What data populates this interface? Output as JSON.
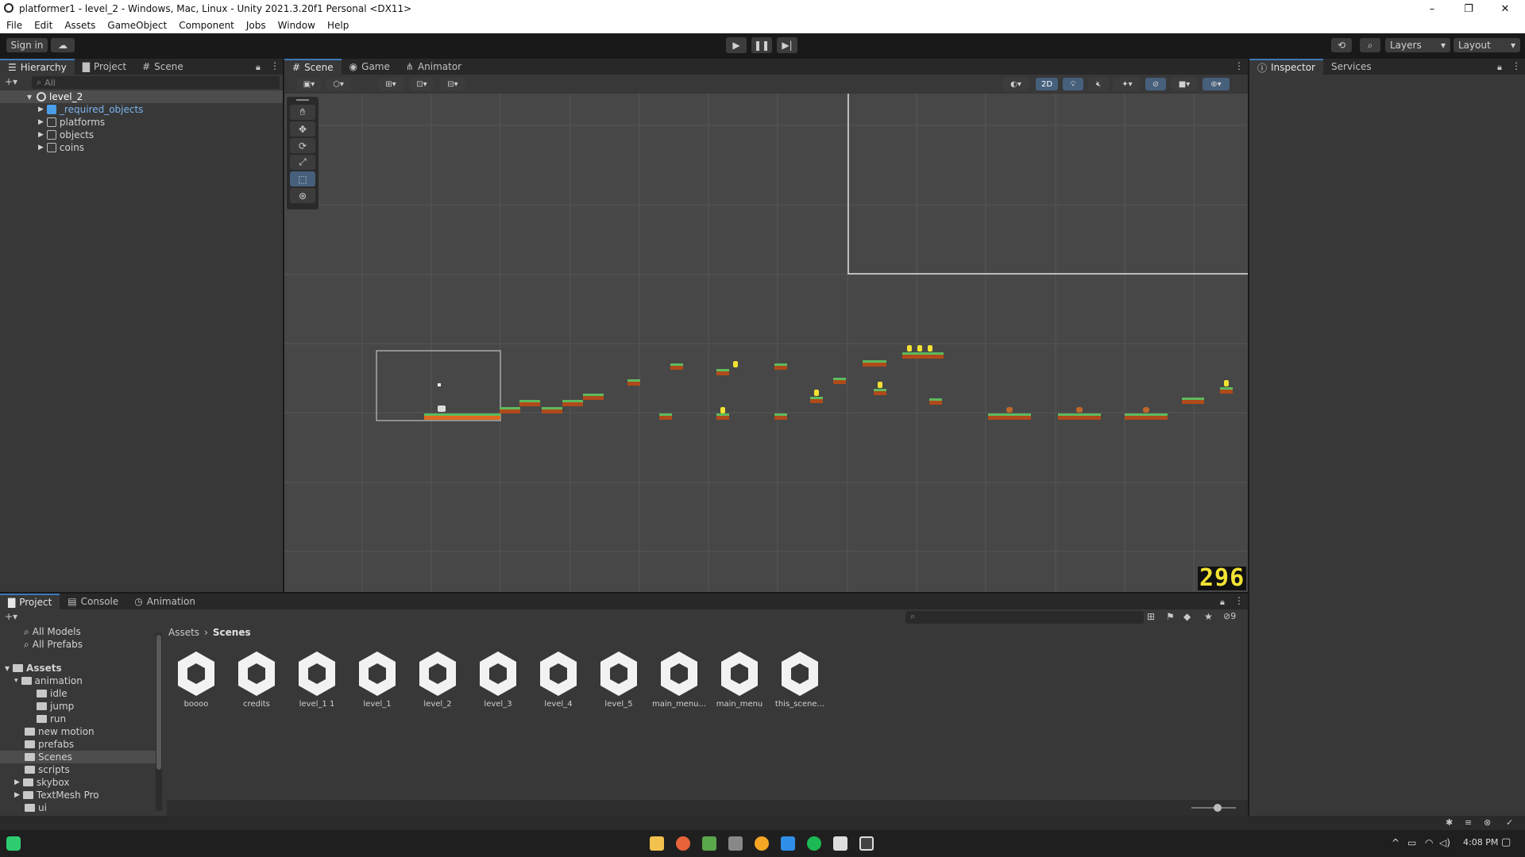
{
  "window": {
    "title": "platformer1 - level_2 - Windows, Mac, Linux - Unity 2021.3.20f1 Personal <DX11>",
    "controls": [
      "–",
      "❐",
      "✕"
    ]
  },
  "menu": [
    "File",
    "Edit",
    "Assets",
    "GameObject",
    "Component",
    "Jobs",
    "Window",
    "Help"
  ],
  "toolbar": {
    "sign_in": "Sign in",
    "layers_label": "Layers",
    "layout_label": "Layout"
  },
  "hierarchy": {
    "tabs": [
      "Hierarchy",
      "Project",
      "Scene"
    ],
    "search_placeholder": "All",
    "scene_root": "level_2",
    "items": [
      "_required_objects",
      "platforms",
      "objects",
      "coins"
    ]
  },
  "scene": {
    "tabs": [
      "Scene",
      "Game",
      "Animator"
    ],
    "mode_2d": "2D",
    "counter": "296"
  },
  "inspector": {
    "tabs": [
      "Inspector",
      "Services"
    ]
  },
  "project": {
    "tabs": [
      "Project",
      "Console",
      "Animation"
    ],
    "favorites": [
      "All Models",
      "All Prefabs"
    ],
    "tree": {
      "root": "Assets",
      "items": [
        {
          "label": "animation",
          "depth": 1,
          "expanded": true
        },
        {
          "label": "idle",
          "depth": 2
        },
        {
          "label": "jump",
          "depth": 2
        },
        {
          "label": "run",
          "depth": 2
        },
        {
          "label": "new motion",
          "depth": 1
        },
        {
          "label": "prefabs",
          "depth": 1
        },
        {
          "label": "Scenes",
          "depth": 1,
          "selected": true
        },
        {
          "label": "scripts",
          "depth": 1
        },
        {
          "label": "skybox",
          "depth": 1,
          "collapsed": true
        },
        {
          "label": "TextMesh Pro",
          "depth": 1,
          "collapsed": true
        },
        {
          "label": "ui",
          "depth": 1
        }
      ]
    },
    "breadcrumb": [
      "Assets",
      "Scenes"
    ],
    "hidden_count": "9",
    "assets": [
      "boooo",
      "credits",
      "level_1 1",
      "level_1",
      "level_2",
      "level_3",
      "level_4",
      "level_5",
      "main_menu...",
      "main_menu",
      "this_scene..."
    ]
  },
  "taskbar": {
    "time": "4:08 PM"
  },
  "colors": {
    "accent": "#3a79bb",
    "panel": "#383838",
    "scene_bg": "#474747",
    "counter": "#f2e233",
    "grass": "#5dbb5d",
    "dirt": "#b04a1a"
  }
}
